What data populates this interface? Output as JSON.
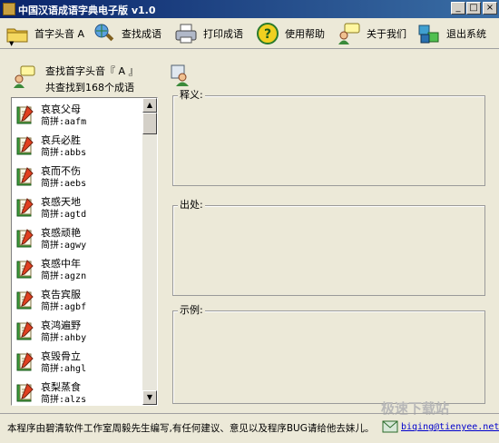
{
  "window": {
    "title": "中国汉语成语字典电子版 v1.0",
    "minimize": "_",
    "maximize": "□",
    "close": "×"
  },
  "toolbar": {
    "items": [
      {
        "label": "首字头音 A",
        "icon": "folder-icon",
        "has_dropdown": true
      },
      {
        "label": "查找成语",
        "icon": "search-globe-icon"
      },
      {
        "label": "打印成语",
        "icon": "printer-icon"
      },
      {
        "label": "使用帮助",
        "icon": "help-icon"
      },
      {
        "label": "关于我们",
        "icon": "chat-user-icon"
      },
      {
        "label": "退出系统",
        "icon": "exit-boxes-icon"
      }
    ],
    "dropdown_arrow": "▼"
  },
  "info": {
    "line1": "查找首字头音『 A 』",
    "line2": "共查找到168个成语"
  },
  "idiom_list": [
    {
      "name": "哀哀父母",
      "pinyin": "简拼:aafm"
    },
    {
      "name": "哀兵必胜",
      "pinyin": "简拼:abbs"
    },
    {
      "name": "哀而不伤",
      "pinyin": "简拼:aebs"
    },
    {
      "name": "哀感天地",
      "pinyin": "简拼:agtd"
    },
    {
      "name": "哀感顽艳",
      "pinyin": "简拼:agwy"
    },
    {
      "name": "哀感中年",
      "pinyin": "简拼:agzn"
    },
    {
      "name": "哀告宾服",
      "pinyin": "简拼:agbf"
    },
    {
      "name": "哀鸿遍野",
      "pinyin": "简拼:ahby"
    },
    {
      "name": "哀毁骨立",
      "pinyin": "简拼:ahgl"
    },
    {
      "name": "哀梨蒸食",
      "pinyin": "简拼:alzs"
    }
  ],
  "scrollbar": {
    "up": "▲",
    "down": "▼"
  },
  "sections": {
    "meaning": "释义:",
    "origin": "出处:",
    "example": "示例:"
  },
  "status": {
    "text": "本程序由碧清软件工作室周毅先生编写,有任何建议、意见以及程序BUG请给他去妹儿。",
    "email": "biqing@tienyee.net"
  },
  "watermark": "极速下载站",
  "colors": {
    "titlebar_start": "#0a246a",
    "titlebar_end": "#3a6ea5",
    "window_bg": "#ece9d8",
    "link": "#0000cc"
  }
}
